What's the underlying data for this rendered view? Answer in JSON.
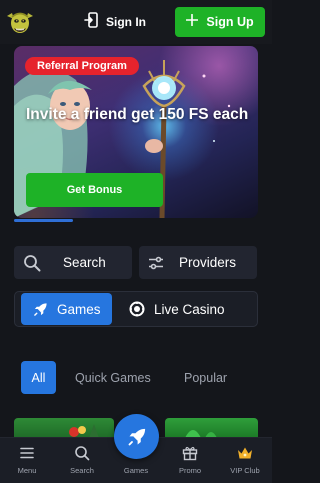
{
  "header": {
    "signin_label": "Sign In",
    "signup_label": "Sign Up",
    "icons": {
      "logo": "goblin-logo",
      "signin": "sign-in-icon",
      "signup": "plus-icon"
    }
  },
  "banner": {
    "badge": "Referral Program",
    "headline": "Invite a friend get 150 FS each",
    "button_label": "Get Bonus"
  },
  "actions": {
    "search_label": "Search",
    "providers_label": "Providers"
  },
  "segments": {
    "games_label": "Games",
    "live_label": "Live Casino",
    "active": "Games"
  },
  "category_tabs": {
    "all": "All",
    "quick": "Quick Games",
    "popular": "Popular",
    "active": "All"
  },
  "bottom_nav": {
    "menu": "Menu",
    "search": "Search",
    "games": "Games",
    "promo": "Promo",
    "vip": "VIP Club"
  },
  "colors": {
    "green": "#1eb227",
    "blue": "#2676df",
    "red_badge": "#e6232d",
    "background": "#14161b",
    "card": "#222530"
  }
}
